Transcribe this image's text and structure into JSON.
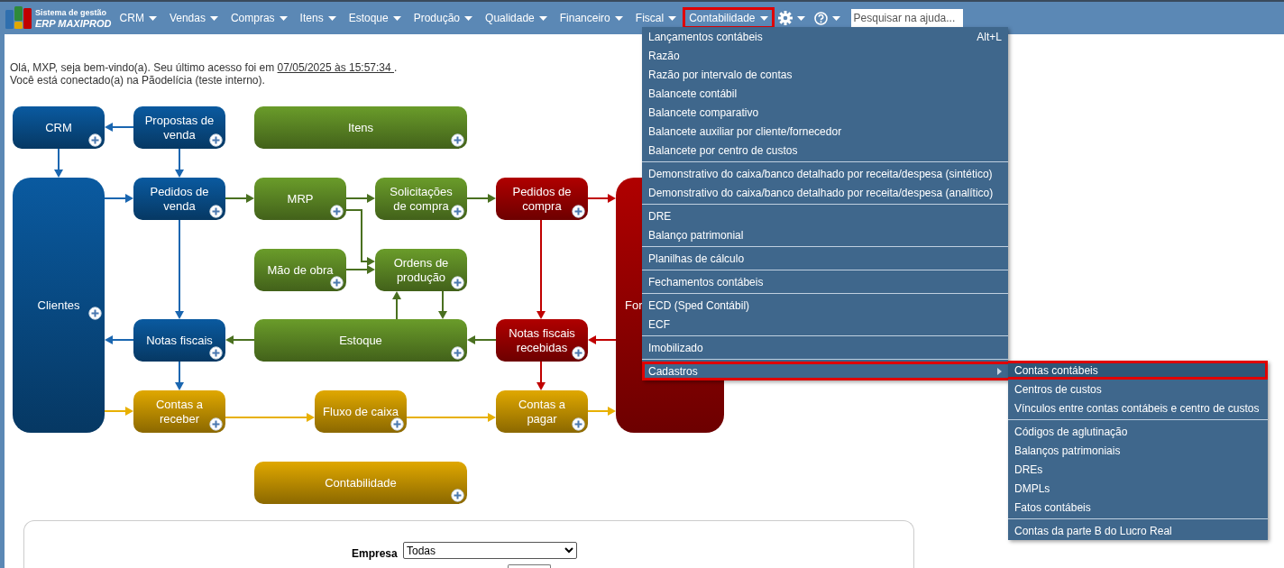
{
  "brand": {
    "caption": "Sistema de gestão",
    "name": "ERP MAXIPROD"
  },
  "nav": [
    {
      "label": "CRM",
      "selected": false
    },
    {
      "label": "Vendas",
      "selected": false
    },
    {
      "label": "Compras",
      "selected": false
    },
    {
      "label": "Itens",
      "selected": false
    },
    {
      "label": "Estoque",
      "selected": false
    },
    {
      "label": "Produção",
      "selected": false
    },
    {
      "label": "Qualidade",
      "selected": false
    },
    {
      "label": "Financeiro",
      "selected": false
    },
    {
      "label": "Fiscal",
      "selected": false
    },
    {
      "label": "Contabilidade",
      "selected": true
    }
  ],
  "search": {
    "placeholder": "Pesquisar na ajuda..."
  },
  "welcome": {
    "before": "Olá, MXP, seja bem-vindo(a). Seu último acesso foi em ",
    "last_access": "07/05/2025 às 15:57:34 ",
    "after": ".",
    "line2": "Você está conectado(a) na Pãodelícia (teste interno)."
  },
  "diagram": {
    "nodes": [
      {
        "label": "CRM",
        "color": "#0a5aa0"
      },
      {
        "label": "Propostas de venda",
        "color": "#0a5aa0"
      },
      {
        "label": "Itens",
        "color": "#6a9c2a"
      },
      {
        "label": "Clientes",
        "color": "#0a5aa0"
      },
      {
        "label": "Pedidos de venda",
        "color": "#0a5aa0"
      },
      {
        "label": "MRP",
        "color": "#6a9c2a"
      },
      {
        "label": "Solicitações de compra",
        "color": "#6a9c2a"
      },
      {
        "label": "Pedidos de compra",
        "color": "#b00000"
      },
      {
        "label": "For",
        "color": "#b00000"
      },
      {
        "label": "Mão de obra",
        "color": "#6a9c2a"
      },
      {
        "label": "Ordens de produção",
        "color": "#6a9c2a"
      },
      {
        "label": "Notas fiscais",
        "color": "#0a5aa0"
      },
      {
        "label": "Estoque",
        "color": "#6a9c2a"
      },
      {
        "label": "Notas fiscais recebidas",
        "color": "#b00000"
      },
      {
        "label": "Contas a receber",
        "color": "#e0a800"
      },
      {
        "label": "Fluxo de caixa",
        "color": "#e0a800"
      },
      {
        "label": "Contas a pagar",
        "color": "#e0a800"
      },
      {
        "label": "Contabilidade",
        "color": "#e0a800"
      }
    ]
  },
  "menu": {
    "groups": [
      [
        {
          "label": "Lançamentos contábeis",
          "shortcut": "Alt+L",
          "selected": false
        },
        {
          "label": "Razão",
          "selected": false
        },
        {
          "label": "Razão por intervalo de contas",
          "selected": false
        },
        {
          "label": "Balancete contábil",
          "selected": false
        },
        {
          "label": "Balancete comparativo",
          "selected": false
        },
        {
          "label": "Balancete auxiliar por cliente/fornecedor",
          "selected": false
        },
        {
          "label": "Balancete por centro de custos",
          "selected": false
        }
      ],
      [
        {
          "label": "Demonstrativo do caixa/banco detalhado por receita/despesa (sintético)",
          "selected": false
        },
        {
          "label": "Demonstrativo do caixa/banco detalhado por receita/despesa (analítico)",
          "selected": false
        }
      ],
      [
        {
          "label": "DRE",
          "selected": false
        },
        {
          "label": "Balanço patrimonial",
          "selected": false
        }
      ],
      [
        {
          "label": "Planilhas de cálculo",
          "selected": false
        }
      ],
      [
        {
          "label": "Fechamentos contábeis",
          "selected": false
        }
      ],
      [
        {
          "label": "ECD (Sped Contábil)",
          "selected": false
        },
        {
          "label": "ECF",
          "selected": false
        }
      ],
      [
        {
          "label": "Imobilizado",
          "selected": false
        }
      ],
      [
        {
          "label": "Cadastros",
          "selected": false,
          "highlighted": true,
          "kind": "submenu"
        }
      ]
    ],
    "submenu": {
      "groups": [
        [
          {
            "label": "Contas contábeis",
            "selected": true,
            "highlighted": true
          },
          {
            "label": "Centros de custos",
            "selected": false
          },
          {
            "label": "Vínculos entre contas contábeis e centro de custos",
            "selected": false
          }
        ],
        [
          {
            "label": "Códigos de aglutinação",
            "selected": false
          },
          {
            "label": "Balanços patrimoniais",
            "selected": false
          },
          {
            "label": "DREs",
            "selected": false
          },
          {
            "label": "DMPLs",
            "selected": false
          },
          {
            "label": "Fatos contábeis",
            "selected": false
          }
        ],
        [
          {
            "label": "Contas da parte B do Lucro Real",
            "selected": false
          }
        ]
      ]
    }
  },
  "form": {
    "company_label": "Empresa",
    "company_value": "Todas"
  }
}
